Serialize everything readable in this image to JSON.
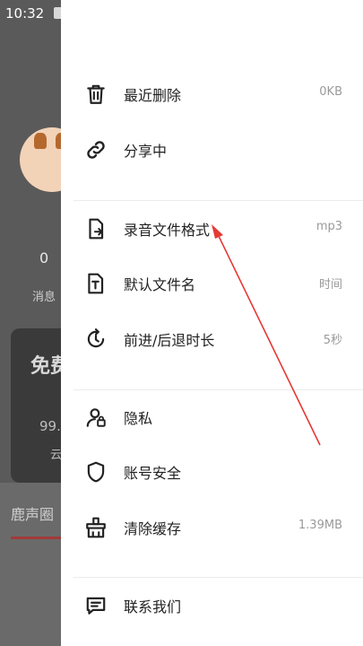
{
  "status_bar": {
    "time": "10:32"
  },
  "background": {
    "count": "0",
    "message_label": "消息",
    "card_title": "免费",
    "card_number": "99.",
    "card_sub": "云",
    "tab_label": "鹿声圈"
  },
  "drawer": {
    "items": [
      {
        "label": "最近删除",
        "value": "0KB"
      },
      {
        "label": "分享中",
        "value": ""
      },
      {
        "label": "录音文件格式",
        "value": "mp3"
      },
      {
        "label": "默认文件名",
        "value": "时间"
      },
      {
        "label": "前进/后退时长",
        "value": "5秒"
      },
      {
        "label": "隐私",
        "value": ""
      },
      {
        "label": "账号安全",
        "value": ""
      },
      {
        "label": "清除缓存",
        "value": "1.39MB"
      },
      {
        "label": "联系我们",
        "value": ""
      }
    ]
  },
  "annotation": {
    "arrow_color": "#e53935"
  }
}
